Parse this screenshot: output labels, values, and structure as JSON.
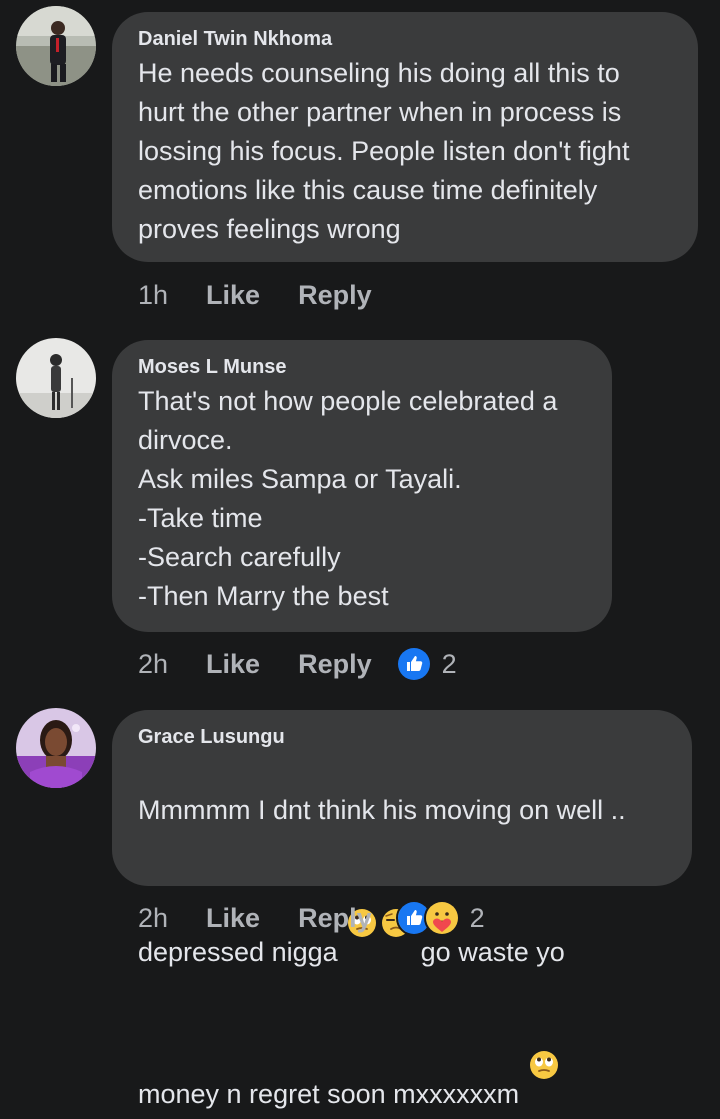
{
  "comments": [
    {
      "author": "Daniel Twin Nkhoma",
      "text": "He needs counseling his doing all this to\nhurt the other partner when in process is\nlossing his focus. People listen don't fight\nemotions like this cause time definitely\nproves feelings wrong",
      "time": "1h",
      "like_label": "Like",
      "reply_label": "Reply"
    },
    {
      "author": "Moses L Munse",
      "text": "That's not how people celebrated a\ndirvoce.\nAsk miles Sampa or Tayali.\n-Take time\n-Search carefully\n-Then Marry the best",
      "time": "2h",
      "like_label": "Like",
      "reply_label": "Reply",
      "reaction_count": "2",
      "reactions": [
        "like-icon"
      ]
    },
    {
      "author": "Grace Lusungu",
      "line1": "Mmmmm I dnt think his moving on well ..",
      "line2_a": "depressed nigga ",
      "line2_b": " go waste yo",
      "line3_a": "money n regret soon mxxxxxxm ",
      "emojis": [
        "eye-roll-emoji",
        "unamused-emoji",
        "eye-roll-emoji"
      ],
      "time": "2h",
      "like_label": "Like",
      "reply_label": "Reply",
      "reaction_count": "2",
      "reactions": [
        "like-icon",
        "care-icon"
      ]
    }
  ],
  "colors": {
    "background": "#18191a",
    "bubble": "#3a3b3c",
    "text": "#e4e6eb",
    "meta": "#b0b3b8",
    "like_blue": "#1877f2"
  }
}
